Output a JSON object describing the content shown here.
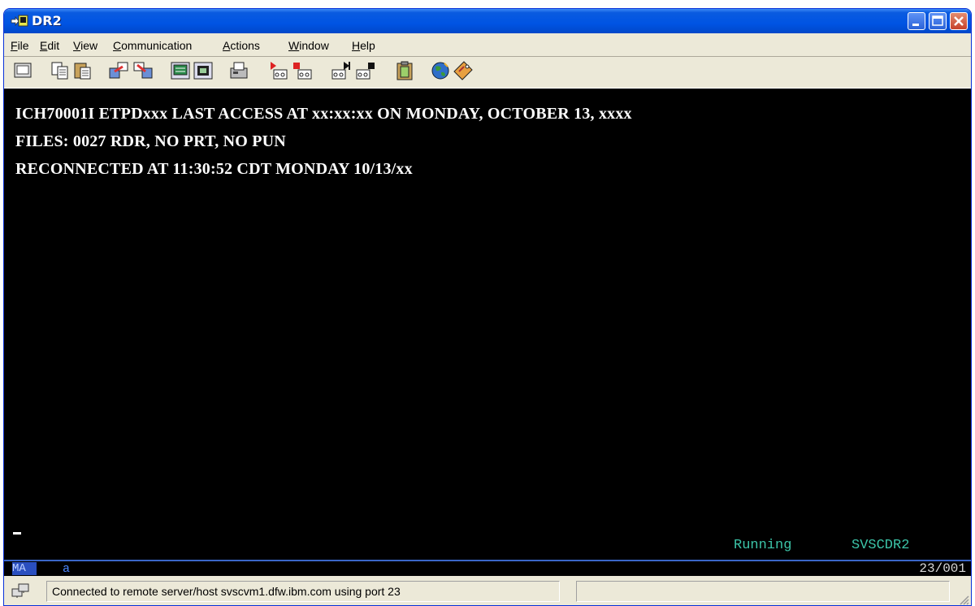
{
  "window": {
    "title": "DR2"
  },
  "menu": {
    "items": [
      {
        "label": "File",
        "u": "F",
        "rest": "ile"
      },
      {
        "label": "Edit",
        "u": "E",
        "rest": "dit"
      },
      {
        "label": "View",
        "u": "V",
        "rest": "iew"
      },
      {
        "label": "Communication",
        "u": "C",
        "rest": "ommunication"
      },
      {
        "label": "Actions",
        "u": "A",
        "rest": "ctions"
      },
      {
        "label": "Window",
        "u": "W",
        "rest": "indow"
      },
      {
        "label": "Help",
        "u": "H",
        "rest": "elp"
      }
    ]
  },
  "toolbar": {
    "buttons": [
      {
        "icon": "display-session-icon"
      },
      {
        "icon": "copy-icon"
      },
      {
        "icon": "paste-icon"
      },
      {
        "icon": "send-file-icon"
      },
      {
        "icon": "receive-file-icon"
      },
      {
        "icon": "keyboard-map-icon"
      },
      {
        "icon": "color-map-icon"
      },
      {
        "icon": "print-screen-icon"
      },
      {
        "icon": "record-macro-icon"
      },
      {
        "icon": "stop-macro-icon"
      },
      {
        "icon": "play-macro-icon"
      },
      {
        "icon": "macro-stop-play-icon"
      },
      {
        "icon": "clipboard-icon"
      },
      {
        "icon": "globe-icon"
      },
      {
        "icon": "help-tag-icon"
      }
    ]
  },
  "terminal": {
    "lines": [
      "ICH70001I ETPDxxx LAST ACCESS AT xx:xx:xx ON MONDAY, OCTOBER 13, xxxx",
      "FILES: 0027 RDR, NO PRT, NO PUN",
      "RECONNECTED AT 11:30:52 CDT MONDAY 10/13/xx"
    ],
    "status": "Running",
    "host_id": "SVSCDR2"
  },
  "oia": {
    "indicator": "MA",
    "mode": "a",
    "cursor_position": "23/001"
  },
  "statusbar": {
    "message": "Connected to remote server/host svscvm1.dfw.ibm.com using port 23"
  }
}
